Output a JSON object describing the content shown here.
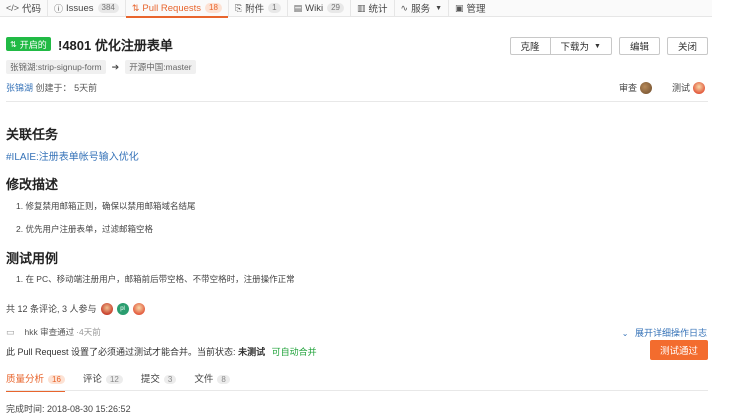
{
  "nav": {
    "items": [
      {
        "icon": "code-icon",
        "glyph": "</>",
        "label": "代码",
        "count": ""
      },
      {
        "icon": "issue-icon",
        "glyph": "ⓘ",
        "label": "Issues",
        "count": "384"
      },
      {
        "icon": "pull-request-icon",
        "glyph": "⇅",
        "label": "Pull Requests",
        "count": "18"
      },
      {
        "icon": "attachment-icon",
        "glyph": "⎘",
        "label": "附件",
        "count": "1"
      },
      {
        "icon": "wiki-icon",
        "glyph": "▤",
        "label": "Wiki",
        "count": "29"
      },
      {
        "icon": "stats-icon",
        "glyph": "▥",
        "label": "统计",
        "count": ""
      },
      {
        "icon": "service-icon",
        "glyph": "∿",
        "label": "服务",
        "count": ""
      },
      {
        "icon": "manage-icon",
        "glyph": "▣",
        "label": "管理",
        "count": ""
      }
    ]
  },
  "pr": {
    "status": "开启的",
    "title": "!4801 优化注册表单",
    "source_branch": "张锦湖:strip-signup-form",
    "target_branch": "开源中国:master",
    "author": "张锦湖",
    "created_label": "创建于：",
    "created_ago": "5天前",
    "reviewer_label": "审查",
    "tester_label": "测试"
  },
  "actions": {
    "clone": "克隆",
    "download": "下载为",
    "edit": "编辑",
    "close": "关闭"
  },
  "content": {
    "task_heading": "关联任务",
    "task_link": "#ILAIE:注册表单帐号输入优化",
    "desc_heading": "修改描述",
    "desc_items": [
      "1. 修复禁用邮箱正则，确保以禁用邮箱域名结尾",
      "2. 优先用户注册表单，过滤邮箱空格"
    ],
    "test_heading": "测试用例",
    "test_items": [
      "1. 在 PC、移动端注册用户，邮箱前后带空格、不带空格时，注册操作正常"
    ]
  },
  "activity": {
    "participants": "共 12 条评论, 3 人参与",
    "log_user": "hkk",
    "log_action": "审查通过",
    "log_time": "·4天前",
    "expand": "展开详细操作日志",
    "warn_text": "此 Pull Request 设置了必须通过测试才能合并。当前状态:",
    "warn_state": "未测试",
    "warn_ok": "可自动合并",
    "test_pass_button": "测试通过"
  },
  "tabs": [
    {
      "label": "质量分析",
      "count": "16"
    },
    {
      "label": "评论",
      "count": "12"
    },
    {
      "label": "提交",
      "count": "3"
    },
    {
      "label": "文件",
      "count": "8"
    }
  ],
  "finish_time": "完成时间: 2018-08-30 15:26:52",
  "colors": {
    "accent": "#e8652d",
    "open_badge": "#21ba45",
    "link": "#3673b8",
    "test_button": "#f36c2e"
  }
}
